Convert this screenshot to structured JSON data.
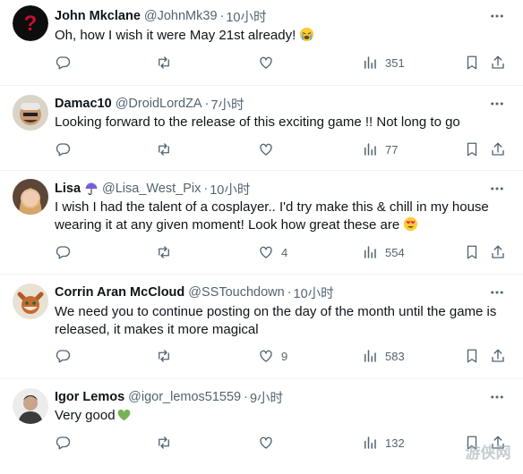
{
  "replies": [
    {
      "name": "John Mkclane",
      "handle": "@JohnMk39",
      "time": "10小时",
      "lines": [
        "Oh, how I wish it were May 21st already!"
      ],
      "emoji": "weary-cry-emoji",
      "replies_count": "",
      "reposts": "",
      "likes": "",
      "views": "351"
    },
    {
      "name": "Damac10",
      "handle": "@DroidLordZA",
      "time": "7小时",
      "lines": [
        "Looking forward to the release of this exciting game !! Not long to go"
      ],
      "emoji": "",
      "replies_count": "",
      "reposts": "",
      "likes": "",
      "views": "77"
    },
    {
      "name": "Lisa",
      "handle": "@Lisa_West_Pix",
      "time": "10小时",
      "lines": [
        "I wish I had the talent of a cosplayer.. I'd try make this & chill in my house",
        "wearing it at any given moment! Look how great these are"
      ],
      "emoji": "heart-eyes-emoji",
      "badge": "umbrella-emoji",
      "replies_count": "",
      "reposts": "",
      "likes": "4",
      "views": "554"
    },
    {
      "name": "Corrin Aran McCloud",
      "handle": "@SSTouchdown",
      "time": "10小时",
      "lines": [
        "We need you to continue posting on the day of the month until the game is",
        "released, it makes it more magical"
      ],
      "emoji": "",
      "replies_count": "",
      "reposts": "",
      "likes": "9",
      "views": "583"
    },
    {
      "name": "Igor Lemos",
      "handle": "@igor_lemos51559",
      "time": "9小时",
      "lines": [
        "Very good"
      ],
      "emoji": "green-heart-emoji",
      "replies_count": "",
      "reposts": "",
      "likes": "",
      "views": "132"
    }
  ],
  "icons": {
    "reply": "reply-icon",
    "repost": "repost-icon",
    "like": "heart-icon",
    "views": "views-icon",
    "bookmark": "bookmark-icon",
    "share": "share-icon",
    "more": "more-icon"
  },
  "colors": {
    "text": "#0f1419",
    "secondary": "#536471",
    "divider": "#eff3f4"
  },
  "watermark": "游侠网"
}
